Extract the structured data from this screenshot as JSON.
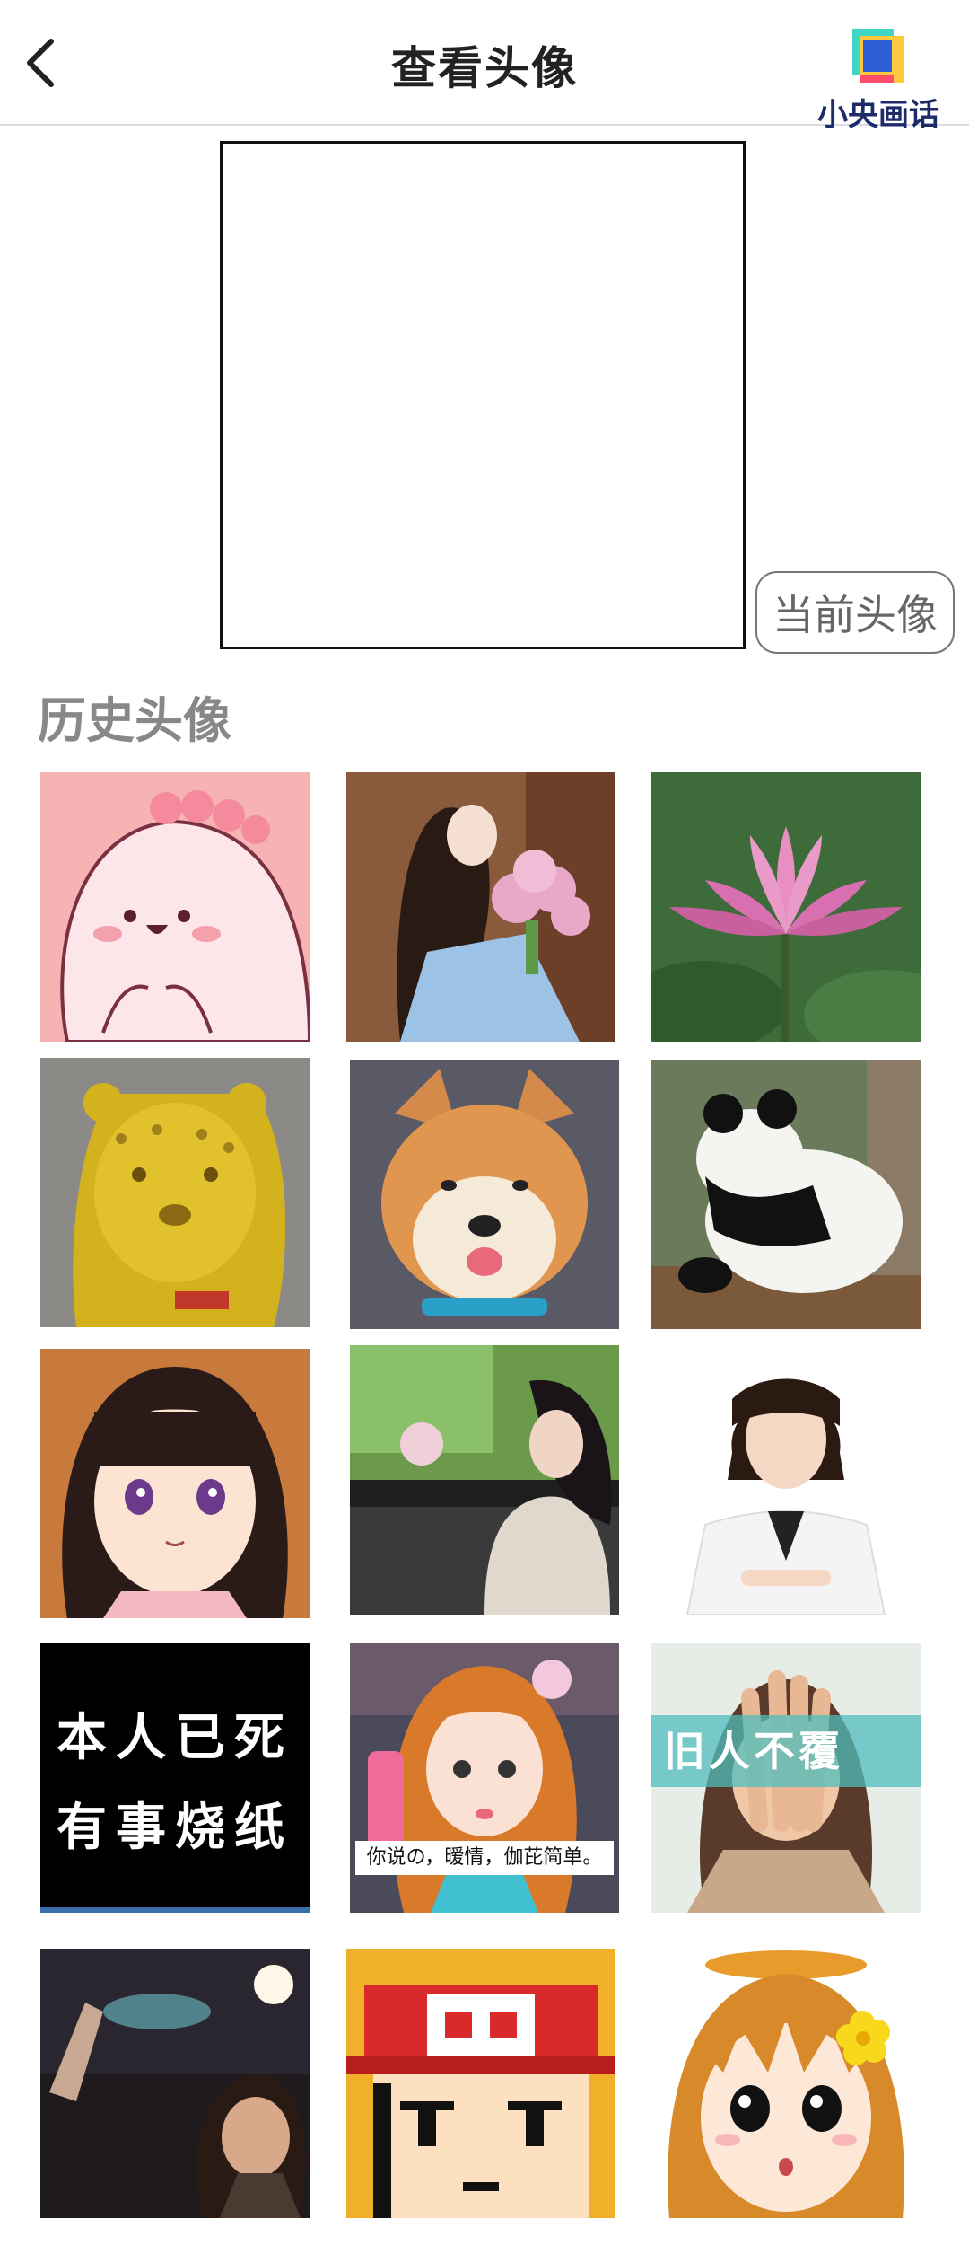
{
  "header": {
    "title": "查看头像",
    "back_icon": "chevron-left-icon",
    "brand_name": "小央画话",
    "brand_colors": [
      "#3fd6c6",
      "#2f5fd8",
      "#ff4d6d",
      "#ffc83d"
    ]
  },
  "current_avatar": {
    "button_label": "当前头像"
  },
  "history": {
    "title": "历史头像",
    "items": [
      {
        "subject": "pink-cartoon-creature"
      },
      {
        "subject": "girl-with-flowers-illustration"
      },
      {
        "subject": "pink-lotus-flower"
      },
      {
        "subject": "golden-leopard-statue"
      },
      {
        "subject": "shiba-inu-dog"
      },
      {
        "subject": "panda-from-behind"
      },
      {
        "subject": "anime-girl-dark-hair"
      },
      {
        "subject": "girl-in-car"
      },
      {
        "subject": "woman-white-blazer"
      },
      {
        "subject": "text-avatar",
        "lines": [
          "本人已死",
          "有事烧纸"
        ]
      },
      {
        "subject": "girl-with-orange-hair",
        "caption": "你说の，暧情，伽芘简单。"
      },
      {
        "subject": "girl-hands-over-face",
        "band_text": "旧人不覆"
      },
      {
        "subject": "night-selfie"
      },
      {
        "subject": "pixel-cartoon-red-cap"
      },
      {
        "subject": "cartoon-girl-flower"
      }
    ]
  }
}
